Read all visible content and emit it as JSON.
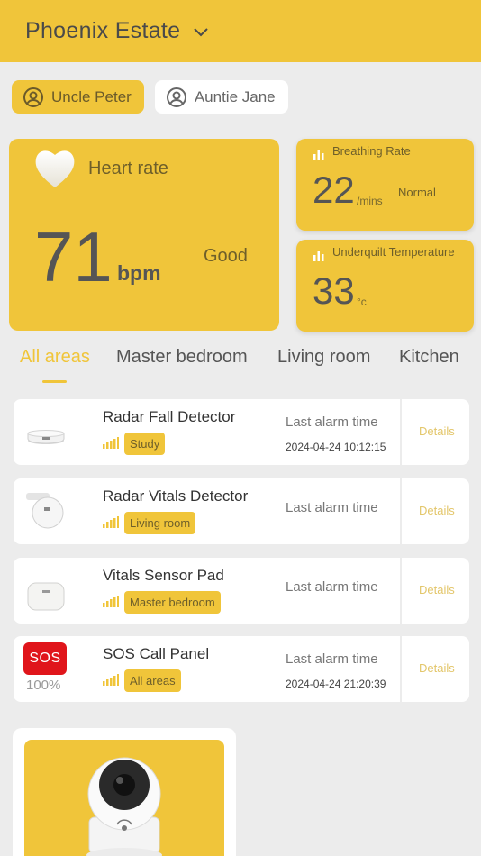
{
  "header": {
    "title": "Phoenix Estate"
  },
  "users": [
    {
      "name": "Uncle Peter",
      "active": true
    },
    {
      "name": "Auntie Jane",
      "active": false
    }
  ],
  "heart_rate": {
    "label": "Heart rate",
    "value": "71",
    "unit": "bpm",
    "status": "Good"
  },
  "breathing": {
    "label": "Breathing Rate",
    "value": "22",
    "unit": "/mins",
    "status": "Normal"
  },
  "temperature": {
    "label": "Underquilt Temperature",
    "value": "33",
    "unit": "°c"
  },
  "tabs": [
    "All areas",
    "Master bedroom",
    "Living room",
    "Kitchen"
  ],
  "devices": [
    {
      "name": "Radar Fall Detector",
      "location": "Study",
      "alarm_label": "Last alarm time",
      "alarm_time": "2024-04-24 10:12:15",
      "details": "Details"
    },
    {
      "name": "Radar Vitals Detector",
      "location": "Living room",
      "alarm_label": "Last alarm time",
      "alarm_time": "",
      "details": "Details"
    },
    {
      "name": "Vitals Sensor Pad",
      "location": "Master bedroom",
      "alarm_label": "Last alarm time",
      "alarm_time": "",
      "details": "Details"
    },
    {
      "name": "SOS Call Panel",
      "location": "All areas",
      "alarm_label": "Last alarm time",
      "alarm_time": "2024-04-24 21:20:39",
      "details": "Details",
      "badge": "SOS",
      "battery": "100%"
    }
  ],
  "colors": {
    "accent": "#f0c53a",
    "background": "#ececec",
    "sos": "#e0151b"
  }
}
